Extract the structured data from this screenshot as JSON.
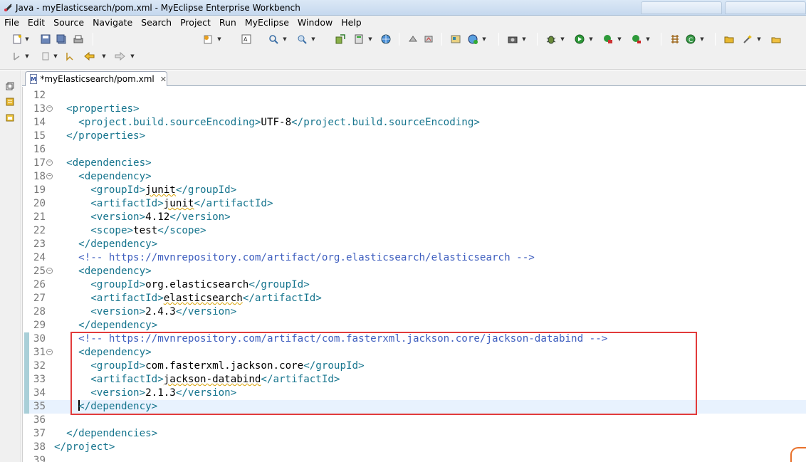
{
  "window": {
    "title": "Java - myElasticsearch/pom.xml - MyEclipse Enterprise Workbench"
  },
  "menu": [
    "File",
    "Edit",
    "Source",
    "Navigate",
    "Search",
    "Project",
    "Run",
    "MyEclipse",
    "Window",
    "Help"
  ],
  "editor_tab": {
    "label": "*myElasticsearch/pom.xml",
    "icon_text": "M",
    "close": "✕"
  },
  "code_lines": [
    {
      "num": "12",
      "fold": false,
      "mark": false,
      "current": false,
      "segments": []
    },
    {
      "num": "13",
      "fold": true,
      "mark": false,
      "current": false,
      "segments": [
        {
          "t": "  <properties>",
          "c": "tg"
        }
      ]
    },
    {
      "num": "14",
      "fold": false,
      "mark": false,
      "current": false,
      "segments": [
        {
          "t": "    <project.build.sourceEncoding>",
          "c": "tg"
        },
        {
          "t": "UTF-8",
          "c": "tx"
        },
        {
          "t": "</project.build.sourceEncoding>",
          "c": "tg"
        }
      ]
    },
    {
      "num": "15",
      "fold": false,
      "mark": false,
      "current": false,
      "segments": [
        {
          "t": "  </properties>",
          "c": "tg"
        }
      ]
    },
    {
      "num": "16",
      "fold": false,
      "mark": false,
      "current": false,
      "segments": []
    },
    {
      "num": "17",
      "fold": true,
      "mark": false,
      "current": false,
      "segments": [
        {
          "t": "  <dependencies>",
          "c": "tg"
        }
      ]
    },
    {
      "num": "18",
      "fold": true,
      "mark": false,
      "current": false,
      "segments": [
        {
          "t": "    <dependency>",
          "c": "tg"
        }
      ]
    },
    {
      "num": "19",
      "fold": false,
      "mark": false,
      "current": false,
      "segments": [
        {
          "t": "      <groupId>",
          "c": "tg"
        },
        {
          "t": "junit",
          "c": "tx sq"
        },
        {
          "t": "</groupId>",
          "c": "tg"
        }
      ]
    },
    {
      "num": "20",
      "fold": false,
      "mark": false,
      "current": false,
      "segments": [
        {
          "t": "      <artifactId>",
          "c": "tg"
        },
        {
          "t": "junit",
          "c": "tx sq"
        },
        {
          "t": "</artifactId>",
          "c": "tg"
        }
      ]
    },
    {
      "num": "21",
      "fold": false,
      "mark": false,
      "current": false,
      "segments": [
        {
          "t": "      <version>",
          "c": "tg"
        },
        {
          "t": "4.12",
          "c": "tx"
        },
        {
          "t": "</version>",
          "c": "tg"
        }
      ]
    },
    {
      "num": "22",
      "fold": false,
      "mark": false,
      "current": false,
      "segments": [
        {
          "t": "      <scope>",
          "c": "tg"
        },
        {
          "t": "test",
          "c": "tx"
        },
        {
          "t": "</scope>",
          "c": "tg"
        }
      ]
    },
    {
      "num": "23",
      "fold": false,
      "mark": false,
      "current": false,
      "segments": [
        {
          "t": "    </dependency>",
          "c": "tg"
        }
      ]
    },
    {
      "num": "24",
      "fold": false,
      "mark": false,
      "current": false,
      "segments": [
        {
          "t": "    <!-- https://mvnrepository.com/artifact/org.elasticsearch/elasticsearch -->",
          "c": "cm"
        }
      ]
    },
    {
      "num": "25",
      "fold": true,
      "mark": false,
      "current": false,
      "segments": [
        {
          "t": "    <dependency>",
          "c": "tg"
        }
      ]
    },
    {
      "num": "26",
      "fold": false,
      "mark": false,
      "current": false,
      "segments": [
        {
          "t": "      <groupId>",
          "c": "tg"
        },
        {
          "t": "org.elasticsearch",
          "c": "tx"
        },
        {
          "t": "</groupId>",
          "c": "tg"
        }
      ]
    },
    {
      "num": "27",
      "fold": false,
      "mark": false,
      "current": false,
      "segments": [
        {
          "t": "      <artifactId>",
          "c": "tg"
        },
        {
          "t": "elasticsearch",
          "c": "tx sq"
        },
        {
          "t": "</artifactId>",
          "c": "tg"
        }
      ]
    },
    {
      "num": "28",
      "fold": false,
      "mark": false,
      "current": false,
      "segments": [
        {
          "t": "      <version>",
          "c": "tg"
        },
        {
          "t": "2.4.3",
          "c": "tx"
        },
        {
          "t": "</version>",
          "c": "tg"
        }
      ]
    },
    {
      "num": "29",
      "fold": false,
      "mark": false,
      "current": false,
      "segments": [
        {
          "t": "    </dependency>",
          "c": "tg"
        }
      ]
    },
    {
      "num": "30",
      "fold": false,
      "mark": true,
      "current": false,
      "segments": [
        {
          "t": "    <!-- https://mvnrepository.com/artifact/com.fasterxml.jackson.core/jackson-databind -->",
          "c": "cm"
        }
      ]
    },
    {
      "num": "31",
      "fold": true,
      "mark": true,
      "current": false,
      "segments": [
        {
          "t": "    <dependency>",
          "c": "tg"
        }
      ]
    },
    {
      "num": "32",
      "fold": false,
      "mark": true,
      "current": false,
      "segments": [
        {
          "t": "      <groupId>",
          "c": "tg"
        },
        {
          "t": "com.fasterxml.jackson.core",
          "c": "tx"
        },
        {
          "t": "</groupId>",
          "c": "tg"
        }
      ]
    },
    {
      "num": "33",
      "fold": false,
      "mark": true,
      "current": false,
      "segments": [
        {
          "t": "      <artifactId>",
          "c": "tg"
        },
        {
          "t": "jackson-databind",
          "c": "tx sq"
        },
        {
          "t": "</artifactId>",
          "c": "tg"
        }
      ]
    },
    {
      "num": "34",
      "fold": false,
      "mark": true,
      "current": false,
      "segments": [
        {
          "t": "      <version>",
          "c": "tg"
        },
        {
          "t": "2.1.3",
          "c": "tx"
        },
        {
          "t": "</version>",
          "c": "tg"
        }
      ]
    },
    {
      "num": "35",
      "fold": false,
      "mark": true,
      "current": true,
      "segments": [
        {
          "t": "    ",
          "c": "tx"
        },
        {
          "t": "CARET",
          "c": "caret"
        },
        {
          "t": "</dependency>",
          "c": "tg"
        }
      ]
    },
    {
      "num": "36",
      "fold": false,
      "mark": false,
      "current": false,
      "segments": []
    },
    {
      "num": "37",
      "fold": false,
      "mark": false,
      "current": false,
      "segments": [
        {
          "t": "  </dependencies>",
          "c": "tg"
        }
      ]
    },
    {
      "num": "38",
      "fold": false,
      "mark": false,
      "current": false,
      "segments": [
        {
          "t": "</project>",
          "c": "tg"
        }
      ]
    },
    {
      "num": "39",
      "fold": false,
      "mark": false,
      "current": false,
      "segments": []
    }
  ],
  "colors": {
    "tag": "#17758e",
    "text": "#000000",
    "comment": "#3f5fbf",
    "highlight_box": "#e23b3b",
    "current_line": "#e8f2fe"
  },
  "toolbar_icons": [
    "new-icon",
    "save-icon",
    "save-all-icon",
    "print-icon",
    "new-wizard-icon",
    "open-type-icon",
    "search-icon",
    "run-icon",
    "debug-icon",
    "server-icon",
    "back-icon",
    "forward-icon"
  ]
}
